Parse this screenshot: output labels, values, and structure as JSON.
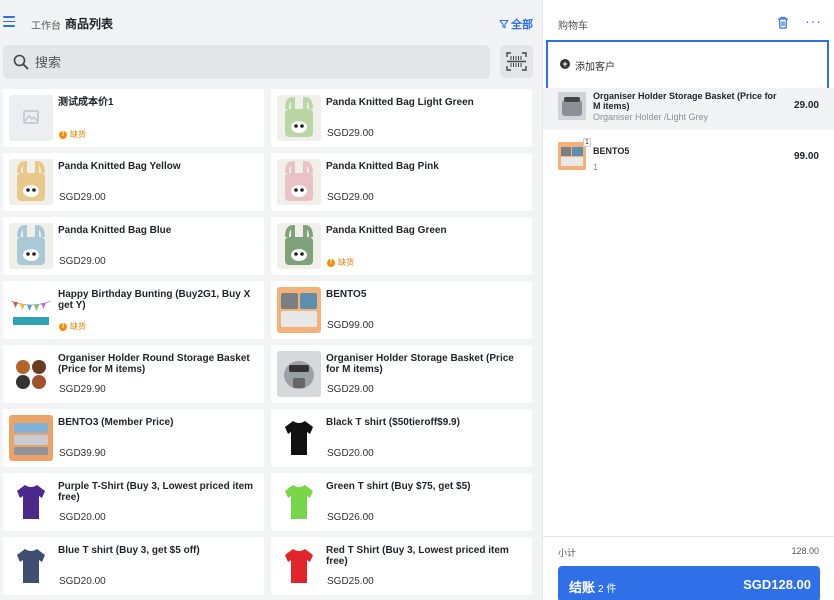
{
  "header": {
    "breadcrumb": "工作台",
    "title": "商品列表",
    "filter_label": "全部"
  },
  "search": {
    "placeholder": "搜索"
  },
  "products": [
    {
      "name": "测试成本价1",
      "price": "",
      "status": "缺货",
      "thumb": "placeholder"
    },
    {
      "name": "Panda Knitted Bag Light Green",
      "price": "SGD29.00",
      "status": "",
      "thumb": "bag-light-green"
    },
    {
      "name": "Panda Knitted Bag Yellow",
      "price": "SGD29.00",
      "status": "",
      "thumb": "bag-yellow"
    },
    {
      "name": "Panda Knitted Bag Pink",
      "price": "SGD29.00",
      "status": "",
      "thumb": "bag-pink"
    },
    {
      "name": "Panda Knitted Bag Blue",
      "price": "SGD29.00",
      "status": "",
      "thumb": "bag-blue"
    },
    {
      "name": "Panda Knitted Bag Green",
      "price": "",
      "status": "缺货",
      "thumb": "bag-green"
    },
    {
      "name": "Happy Birthday Bunting (Buy2G1, Buy X get Y)",
      "price": "",
      "status": "缺货",
      "thumb": "bunting"
    },
    {
      "name": "BENTO5",
      "price": "SGD99.00",
      "status": "",
      "thumb": "bento"
    },
    {
      "name": "Organiser Holder Round Storage Basket (Price for M items)",
      "price": "SGD29.90",
      "status": "",
      "thumb": "round-basket"
    },
    {
      "name": "Organiser Holder Storage Basket (Price for M items)",
      "price": "SGD29.00",
      "status": "",
      "thumb": "basket"
    },
    {
      "name": "BENTO3 (Member Price)",
      "price": "SGD39.90",
      "status": "",
      "thumb": "bento3"
    },
    {
      "name": "Black T shirt ($50tieroff$9.9)",
      "price": "SGD20.00",
      "status": "",
      "thumb": "tshirt-black"
    },
    {
      "name": "Purple T-Shirt (Buy 3, Lowest priced item free)",
      "price": "SGD20.00",
      "status": "",
      "thumb": "tshirt-purple"
    },
    {
      "name": "Green T shirt (Buy $75, get $5)",
      "price": "SGD26.00",
      "status": "",
      "thumb": "tshirt-green"
    },
    {
      "name": "Blue T shirt (Buy 3, get $5 off)",
      "price": "SGD20.00",
      "status": "",
      "thumb": "tshirt-navy"
    },
    {
      "name": "Red T Shirt (Buy 3, Lowest priced item free)",
      "price": "SGD25.00",
      "status": "",
      "thumb": "tshirt-red"
    }
  ],
  "cart": {
    "title": "购物车",
    "add_customer": "添加客户",
    "items": [
      {
        "name": "Organiser Holder Storage Basket (Price for M items)",
        "sub": "Organiser Holder /Light Grey",
        "price": "29.00",
        "qty": ""
      },
      {
        "name": "BENTO5",
        "sub": "1",
        "price": "99.00",
        "qty": "1"
      }
    ],
    "subtotal_label": "小计",
    "subtotal_value": "128.00",
    "checkout_label": "结账",
    "checkout_count": "2 件",
    "checkout_amount": "SGD128.00"
  },
  "colors": {
    "accent": "#2f6fe8",
    "warning": "#f29100"
  }
}
